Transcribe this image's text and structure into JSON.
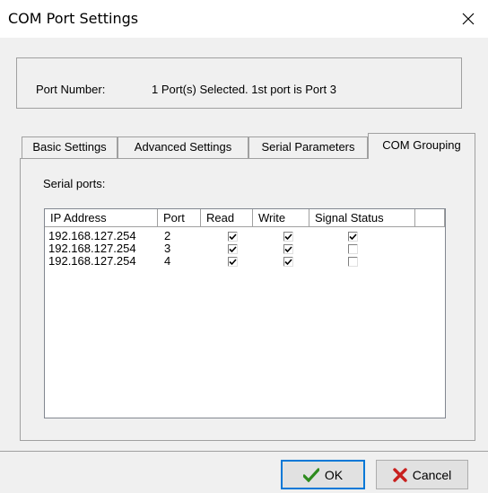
{
  "window": {
    "title": "COM Port Settings"
  },
  "port_info": {
    "label": "Port Number:",
    "value": "1 Port(s) Selected. 1st port is Port 3"
  },
  "tabs": [
    {
      "label": "Basic Settings",
      "active": false
    },
    {
      "label": "Advanced Settings",
      "active": false
    },
    {
      "label": "Serial Parameters",
      "active": false
    },
    {
      "label": "COM Grouping",
      "active": true
    }
  ],
  "serial_ports": {
    "label": "Serial ports:",
    "columns": [
      "IP Address",
      "Port",
      "Read",
      "Write",
      "Signal Status"
    ],
    "rows": [
      {
        "ip": "192.168.127.254",
        "port": "2",
        "read": true,
        "write": true,
        "signal_status": true
      },
      {
        "ip": "192.168.127.254",
        "port": "3",
        "read": true,
        "write": true,
        "signal_status": false
      },
      {
        "ip": "192.168.127.254",
        "port": "4",
        "read": true,
        "write": true,
        "signal_status": false
      }
    ]
  },
  "buttons": {
    "ok": "OK",
    "cancel": "Cancel"
  },
  "icons": {
    "close": "close-icon",
    "ok": "checkmark-icon",
    "cancel": "x-icon"
  },
  "colors": {
    "ok_check": "#2e8b1e",
    "cancel_x": "#c8201e",
    "focus_border": "#0078d7"
  }
}
